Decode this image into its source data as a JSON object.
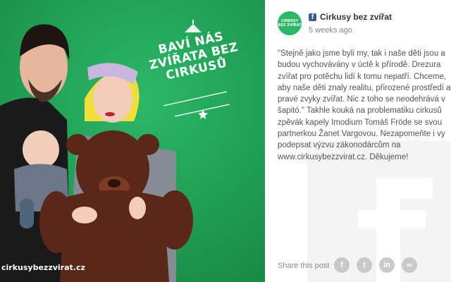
{
  "image": {
    "badge_text": "BAVÍ NÁS ZVÍŘATA BEZ CIRKUSŮ",
    "site_url": "cirkusybezzvirat.cz",
    "background_color": "#1f9d52"
  },
  "post": {
    "avatar_text": "CIRKUSY BEZ ZVÍŘAT",
    "author": "Cirkusy bez zvířat",
    "timestamp": "5 weeks ago",
    "text": "\"Stejně jako jsme byli my, tak i naše děti jsou a budou vychovávány v úctě k přírodě. Drezura zvířat pro potěchu lidí k tomu nepatří. Chceme, aby naše děti znaly realitu, přirozené prostředí a pravé zvyky zvířat. Nic z toho se neodehrává v šapitó.\" Takhle kouká na problematiku cirkusů zpěvák kapely Imodium Tomáš Fröde se svou partnerkou Žanet Vargovou. Nezapomeňte i vy podepsat výzvu zákonodárcům na www.cirkusybezzvirat.cz. Děkujeme!"
  },
  "share": {
    "label": "Share this post",
    "buttons": [
      {
        "name": "facebook",
        "glyph": "f"
      },
      {
        "name": "twitter",
        "glyph": "t"
      },
      {
        "name": "linkedin",
        "glyph": "in"
      },
      {
        "name": "link",
        "glyph": "∞"
      }
    ]
  },
  "colors": {
    "brand_green": "#2bb866",
    "facebook_blue": "#3b5998",
    "share_gray": "#c9c9c9"
  }
}
